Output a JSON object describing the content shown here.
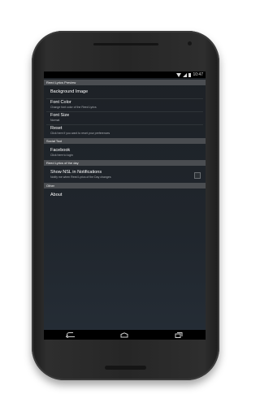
{
  "status_bar": {
    "time": "10:47",
    "icons": [
      "wifi-icon",
      "signal-icon",
      "battery-icon"
    ]
  },
  "preferences": {
    "sections": [
      {
        "header": "Reed Lyrics Preview",
        "items": [
          {
            "title": "Background Image",
            "subtitle": ""
          },
          {
            "title": "Font Color",
            "subtitle": "Change font color of the Reed Lyrics"
          },
          {
            "title": "Font Size",
            "subtitle": "Normal"
          },
          {
            "title": "Reset",
            "subtitle": "Click here if you want to reset your preferences"
          }
        ]
      },
      {
        "header": "Social Tool",
        "items": [
          {
            "title": "Facebook",
            "subtitle": "Click here to login"
          }
        ]
      },
      {
        "header": "Reed Lyrics of the day",
        "items": [
          {
            "title": "Show NSL in Notifications",
            "subtitle": "Notify me when Reed Lyrics of the Day changes",
            "checked": false
          }
        ]
      },
      {
        "header": "Other",
        "items": [
          {
            "title": "About",
            "subtitle": ""
          }
        ]
      }
    ]
  },
  "nav_bar": {
    "buttons": [
      "back-icon",
      "home-icon",
      "recents-icon"
    ]
  },
  "colors": {
    "screen_bg": "#1d2126",
    "section_header_bg": "#4a4d51",
    "phone_body": "#262626"
  }
}
